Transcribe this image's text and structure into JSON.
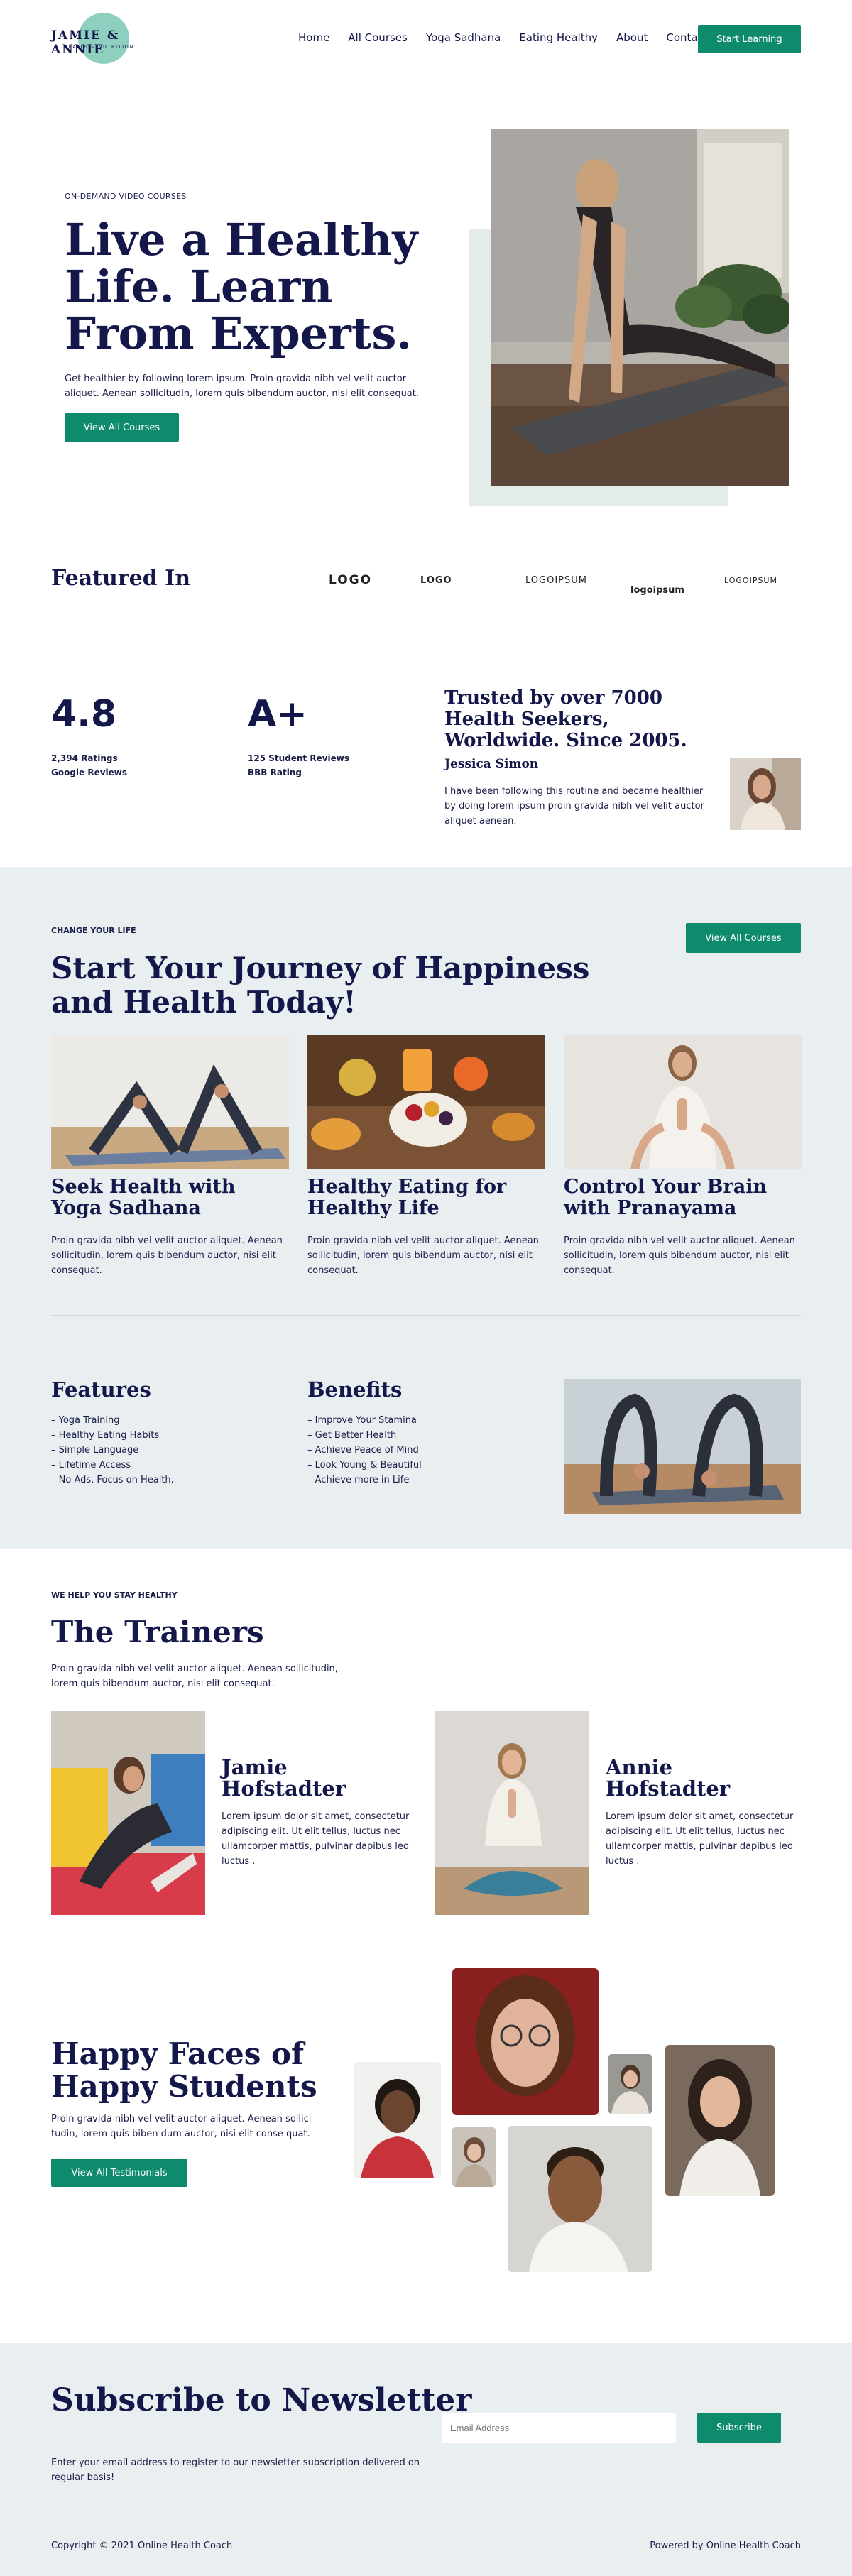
{
  "header": {
    "logo_main": "JAMIE & ANNIE",
    "logo_sub": "HEALTH & NUTRITION",
    "nav": [
      "Home",
      "All Courses",
      "Yoga Sadhana",
      "Eating Healthy",
      "About",
      "Contact"
    ],
    "cta": "Start Learning"
  },
  "hero": {
    "pretitle": "ON-DEMAND VIDEO COURSES",
    "title": "Live a Healthy Life. Learn From Experts.",
    "subtitle": "Get healthier by following lorem ipsum. Proin gravida nibh vel velit auctor aliquet. Aenean sollicitudin, lorem quis bibendum auctor, nisi elit consequat.",
    "button": "View All Courses"
  },
  "featured": {
    "title": "Featured In",
    "logos": [
      "LOGO",
      "LOGO",
      "LOGOIPSUM",
      "logoipsum",
      "LOGOIPSUM"
    ]
  },
  "stats": {
    "rating_value": "4.8",
    "rating_line1": "2,394 Ratings",
    "rating_line2": "Google Reviews",
    "grade_value": "A+",
    "grade_line1": "125 Student Reviews",
    "grade_line2": "BBB Rating"
  },
  "testimonial": {
    "title": "Trusted by over 7000 Health Seekers, Worldwide. Since 2005.",
    "name": "Jessica Simon",
    "text": "I have been following this routine and became healthier by doing lorem ipsum proin gravida nibh vel velit auctor aliquet aenean."
  },
  "journey": {
    "pretitle": "CHANGE YOUR LIFE",
    "button": "View All Courses",
    "title": "Start Your Journey of Happiness and Health Today!",
    "cards": [
      {
        "title": "Seek Health with Yoga Sadhana",
        "text": "Proin gravida nibh vel velit auctor aliquet. Aenean sollicitudin, lorem quis bibendum auctor, nisi elit consequat."
      },
      {
        "title": "Healthy Eating for Healthy Life",
        "text": "Proin gravida nibh vel velit auctor aliquet. Aenean sollicitudin, lorem quis bibendum auctor, nisi elit consequat."
      },
      {
        "title": "Control Your Brain with Pranayama",
        "text": "Proin gravida nibh vel velit auctor aliquet. Aenean sollicitudin, lorem quis bibendum auctor, nisi elit consequat."
      }
    ]
  },
  "features": {
    "title": "Features",
    "items": [
      "– Yoga Training",
      "– Healthy Eating Habits",
      "– Simple Language",
      "– Lifetime Access",
      "– No Ads. Focus on Health."
    ]
  },
  "benefits": {
    "title": "Benefits",
    "items": [
      "– Improve Your Stamina",
      "– Get Better Health",
      "– Achieve Peace of Mind",
      "– Look Young & Beautiful",
      "– Achieve more in Life"
    ]
  },
  "trainers": {
    "pretitle": "WE HELP YOU STAY HEALTHY",
    "title": "The Trainers",
    "subtitle": "Proin gravida nibh vel velit auctor aliquet. Aenean sollicitudin, lorem quis bibendum auctor, nisi elit consequat.",
    "list": [
      {
        "name": "Jamie Hofstadter",
        "text": "Lorem ipsum dolor sit amet, consectetur adipiscing elit. Ut elit tellus, luctus nec ullamcorper mattis, pulvinar dapibus leo luctus ."
      },
      {
        "name": "Annie Hofstadter",
        "text": "Lorem ipsum dolor sit amet, consectetur adipiscing elit. Ut elit tellus, luctus nec ullamcorper mattis, pulvinar dapibus leo luctus ."
      }
    ]
  },
  "happy": {
    "title": "Happy Faces of Happy Students",
    "subtitle": "Proin gravida nibh vel velit auctor aliquet. Aenean sollici tudin, lorem quis biben dum auctor, nisi elit conse quat.",
    "button": "View All Testimonials"
  },
  "newsletter": {
    "title": "Subscribe to Newsletter",
    "placeholder": "Email Address",
    "button": "Subscribe",
    "text": "Enter your email address to register to our newsletter subscription delivered on regular basis!"
  },
  "footer": {
    "copyright": "Copyright © 2021 Online Health Coach",
    "powered": "Powered by Online Health Coach"
  },
  "colors": {
    "accent": "#0e8a6c",
    "navy": "#14174a",
    "section_bg": "#e9eef0",
    "logo_circle": "#8fcfc0"
  }
}
